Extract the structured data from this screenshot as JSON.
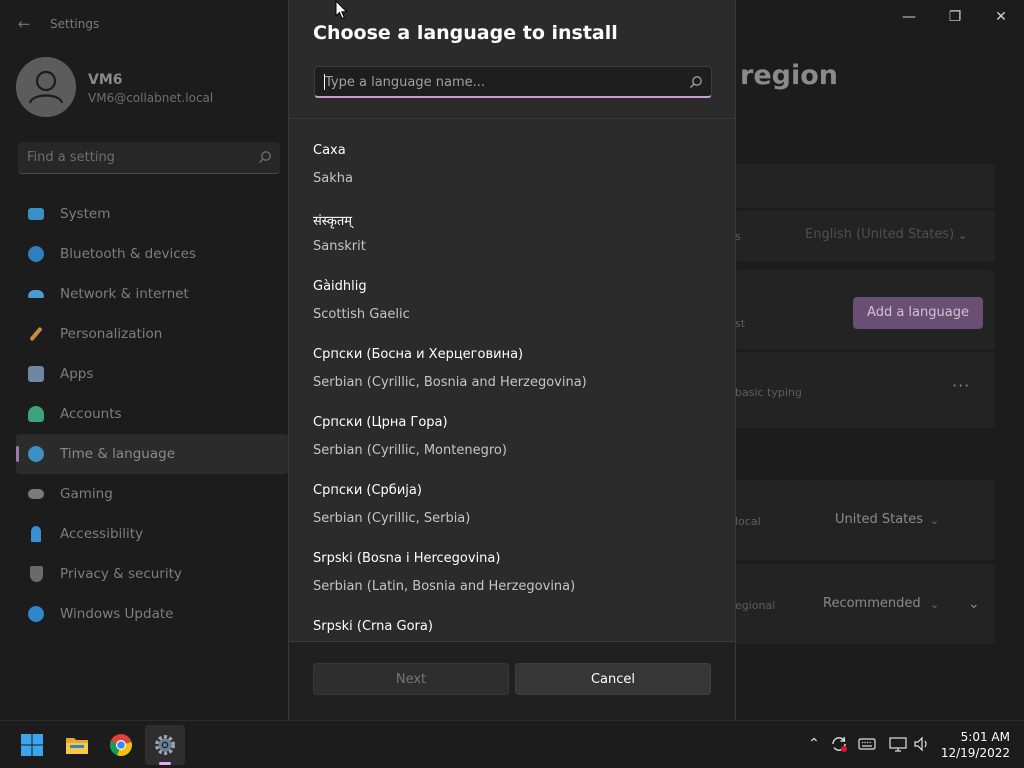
{
  "settings": {
    "app_title": "Settings",
    "user": {
      "name": "VM6",
      "email": "VM6@collabnet.local"
    },
    "search_placeholder": "Find a setting",
    "nav": [
      {
        "label": "System",
        "icon": "monitor-icon",
        "color": "#3a8fc5"
      },
      {
        "label": "Bluetooth & devices",
        "icon": "bluetooth-icon",
        "color": "#2f7fbd"
      },
      {
        "label": "Network & internet",
        "icon": "wifi-icon",
        "color": "#4a9bd4"
      },
      {
        "label": "Personalization",
        "icon": "brush-icon",
        "color": "#c98a4a"
      },
      {
        "label": "Apps",
        "icon": "apps-icon",
        "color": "#6f86a0"
      },
      {
        "label": "Accounts",
        "icon": "person-icon",
        "color": "#3aa47a"
      },
      {
        "label": "Time & language",
        "icon": "globe-clock-icon",
        "color": "#3a8fc5",
        "selected": true
      },
      {
        "label": "Gaming",
        "icon": "controller-icon",
        "color": "#7a7a7a"
      },
      {
        "label": "Accessibility",
        "icon": "accessibility-icon",
        "color": "#3b8ed0"
      },
      {
        "label": "Privacy & security",
        "icon": "shield-icon",
        "color": "#6a6a6a"
      },
      {
        "label": "Windows Update",
        "icon": "refresh-icon",
        "color": "#2f86c9"
      }
    ],
    "page_title_fragment": "region",
    "display_language_value": "English (United States)",
    "add_language_label": "Add a language",
    "fragment_st": "st",
    "fragment_basic_typing": "basic typing",
    "fragment_s": "s",
    "fragment_local": "local",
    "country_value": "United States",
    "fragment_egional": "egional",
    "format_value": "Recommended",
    "more_label": "···"
  },
  "dialog": {
    "title": "Choose a language to install",
    "search_placeholder": "Type a language name...",
    "languages": [
      {
        "native": "Саха",
        "english": "Sakha"
      },
      {
        "native": "संस्कृतम्",
        "english": "Sanskrit"
      },
      {
        "native": "Gàidhlig",
        "english": "Scottish Gaelic"
      },
      {
        "native": "Српски (Босна и Херцеговина)",
        "english": "Serbian (Cyrillic, Bosnia and Herzegovina)"
      },
      {
        "native": "Српски (Црна Гора)",
        "english": "Serbian (Cyrillic, Montenegro)"
      },
      {
        "native": "Српски (Србија)",
        "english": "Serbian (Cyrillic, Serbia)"
      },
      {
        "native": "Srpski (Bosna i Hercegovina)",
        "english": "Serbian (Latin, Bosnia and Herzegovina)"
      },
      {
        "native": "Srpski (Crna Gora)",
        "english": ""
      }
    ],
    "next_label": "Next",
    "cancel_label": "Cancel",
    "accent_color": "#c79fd2"
  },
  "taskbar": {
    "apps": [
      "windows-start-icon",
      "file-explorer-icon",
      "chrome-icon",
      "settings-gear-icon"
    ],
    "clock_time": "5:01 AM",
    "clock_date": "12/19/2022"
  }
}
